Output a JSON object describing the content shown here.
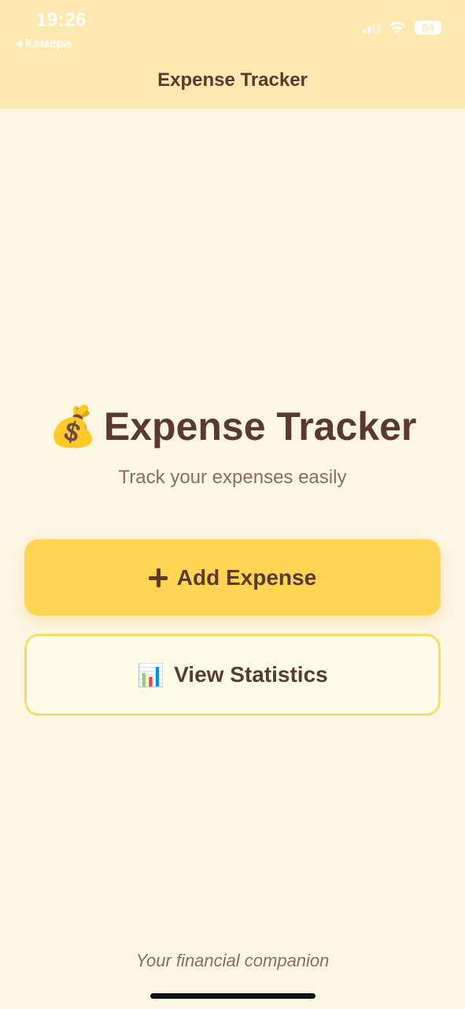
{
  "status_bar": {
    "time": "19:26",
    "back_label": "Камера",
    "battery": "94"
  },
  "nav": {
    "title": "Expense Tracker"
  },
  "hero": {
    "icon": "💰",
    "title": "Expense Tracker",
    "subtitle": "Track your expenses easily"
  },
  "actions": {
    "add_label": "Add Expense",
    "stats_icon": "📊",
    "stats_label": "View Statistics"
  },
  "footer": {
    "tagline": "Your financial companion"
  },
  "icons": {
    "back": "back-arrow-icon",
    "signal": "cellular-signal-icon",
    "wifi": "wifi-icon",
    "battery": "battery-icon",
    "add": "plus-icon",
    "stats": "bar-chart-icon",
    "hero": "money-bag-icon"
  },
  "colors": {
    "header_bg": "#fde9b0",
    "page_bg": "#fdf6e3",
    "primary_button": "#fed452",
    "secondary_button": "#fefce8",
    "secondary_border": "#f7dc6a",
    "text_primary": "#5a3a2e",
    "text_secondary": "#8a6d5f"
  }
}
